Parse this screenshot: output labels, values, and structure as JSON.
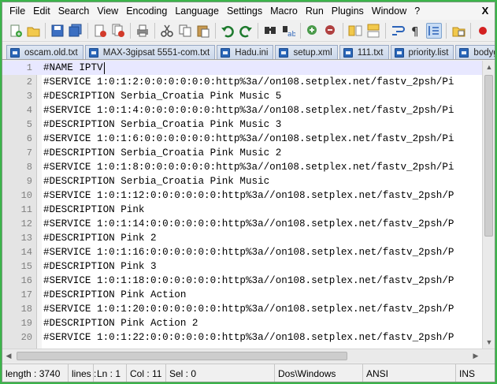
{
  "menu": {
    "items": [
      "File",
      "Edit",
      "Search",
      "View",
      "Encoding",
      "Language",
      "Settings",
      "Macro",
      "Run",
      "Plugins",
      "Window",
      "?"
    ],
    "close_glyph": "X"
  },
  "toolbar": {
    "buttons": [
      "new-file-icon",
      "open-file-icon",
      "save-icon",
      "save-all-icon",
      "close-icon",
      "close-all-icon",
      "print-icon",
      "cut-icon",
      "copy-icon",
      "paste-icon",
      "undo-icon",
      "redo-icon",
      "find-icon",
      "replace-icon",
      "zoom-in-icon",
      "zoom-out-icon",
      "sync-vertical-icon",
      "sync-horizontal-icon",
      "word-wrap-icon",
      "show-all-chars-icon",
      "indent-guide-icon",
      "folder-as-workspace-icon",
      "record-macro-icon"
    ]
  },
  "tabs": [
    {
      "label": "oscam.old.txt"
    },
    {
      "label": "MAX-3gipsat 5551-com.txt"
    },
    {
      "label": "Hadu.ini"
    },
    {
      "label": "setup.xml"
    },
    {
      "label": "111.txt"
    },
    {
      "label": "priority.list"
    },
    {
      "label": "bodygu"
    }
  ],
  "editor": {
    "current_line": 1,
    "lines": [
      {
        "n": "1",
        "text": "#NAME IPTV"
      },
      {
        "n": "2",
        "text": "#SERVICE 1:0:1:2:0:0:0:0:0:0:http%3a//on108.setplex.net/fastv_2psh/Pi"
      },
      {
        "n": "3",
        "text": "#DESCRIPTION Serbia_Croatia Pink Music 5"
      },
      {
        "n": "4",
        "text": "#SERVICE 1:0:1:4:0:0:0:0:0:0:http%3a//on108.setplex.net/fastv_2psh/Pi"
      },
      {
        "n": "5",
        "text": "#DESCRIPTION Serbia_Croatia Pink Music 3"
      },
      {
        "n": "6",
        "text": "#SERVICE 1:0:1:6:0:0:0:0:0:0:http%3a//on108.setplex.net/fastv_2psh/Pi"
      },
      {
        "n": "7",
        "text": "#DESCRIPTION Serbia_Croatia Pink Music 2"
      },
      {
        "n": "8",
        "text": "#SERVICE 1:0:1:8:0:0:0:0:0:0:http%3a//on108.setplex.net/fastv_2psh/Pi"
      },
      {
        "n": "9",
        "text": "#DESCRIPTION Serbia_Croatia Pink Music"
      },
      {
        "n": "10",
        "text": "#SERVICE 1:0:1:12:0:0:0:0:0:0:http%3a//on108.setplex.net/fastv_2psh/P"
      },
      {
        "n": "11",
        "text": "#DESCRIPTION Pink"
      },
      {
        "n": "12",
        "text": "#SERVICE 1:0:1:14:0:0:0:0:0:0:http%3a//on108.setplex.net/fastv_2psh/P"
      },
      {
        "n": "13",
        "text": "#DESCRIPTION Pink 2"
      },
      {
        "n": "14",
        "text": "#SERVICE 1:0:1:16:0:0:0:0:0:0:http%3a//on108.setplex.net/fastv_2psh/P"
      },
      {
        "n": "15",
        "text": "#DESCRIPTION Pink 3"
      },
      {
        "n": "16",
        "text": "#SERVICE 1:0:1:18:0:0:0:0:0:0:http%3a//on108.setplex.net/fastv_2psh/P"
      },
      {
        "n": "17",
        "text": "#DESCRIPTION Pink Action"
      },
      {
        "n": "18",
        "text": "#SERVICE 1:0:1:20:0:0:0:0:0:0:http%3a//on108.setplex.net/fastv_2psh/P"
      },
      {
        "n": "19",
        "text": "#DESCRIPTION Pink Action 2"
      },
      {
        "n": "20",
        "text": "#SERVICE 1:0:1:22:0:0:0:0:0:0:http%3a//on108.setplex.net/fastv_2psh/P"
      }
    ]
  },
  "status": {
    "length": "length : 3740",
    "lines": "lines :",
    "ln": "Ln : 1",
    "col": "Col : 11",
    "sel": "Sel : 0",
    "eol": "Dos\\Windows",
    "encoding": "ANSI",
    "mode": "INS"
  },
  "colors": {
    "window_border": "#3bb54a",
    "current_line": "#e8e8ff",
    "line_number": "#808080"
  }
}
